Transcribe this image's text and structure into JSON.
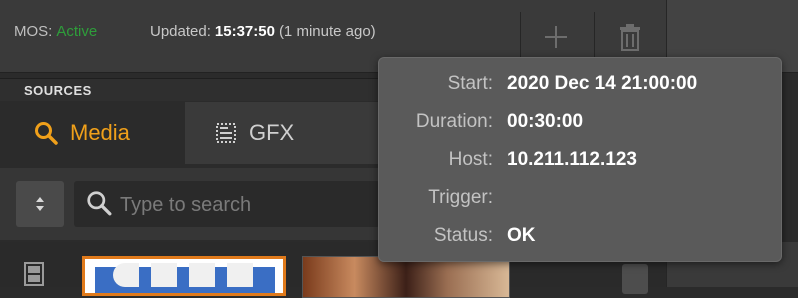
{
  "status": {
    "mos_label": "MOS:",
    "mos_state": "Active",
    "updated_label": "Updated:",
    "updated_time": "15:37:50",
    "updated_relative": "(1 minute ago)",
    "add_icon": "plus-icon",
    "delete_icon": "trash-icon"
  },
  "sources": {
    "header": "SOURCES",
    "tabs": [
      {
        "label": "Media",
        "icon": "search-icon",
        "active": true
      },
      {
        "label": "GFX",
        "icon": "graphics-icon",
        "active": false
      }
    ],
    "sort_icon": "sort-arrows-icon",
    "search": {
      "placeholder": "Type to search",
      "value": ""
    }
  },
  "tooltip": {
    "rows": [
      {
        "key": "Start:",
        "value": "2020 Dec 14 21:00:00"
      },
      {
        "key": "Duration:",
        "value": "00:30:00"
      },
      {
        "key": "Host:",
        "value": "10.211.112.123"
      },
      {
        "key": "Trigger:",
        "value": ""
      },
      {
        "key": "Status:",
        "value": "OK"
      }
    ]
  },
  "colors": {
    "accent": "#f0a01a",
    "active_status": "#2e9e3a",
    "selected_border": "#e07a1b"
  }
}
